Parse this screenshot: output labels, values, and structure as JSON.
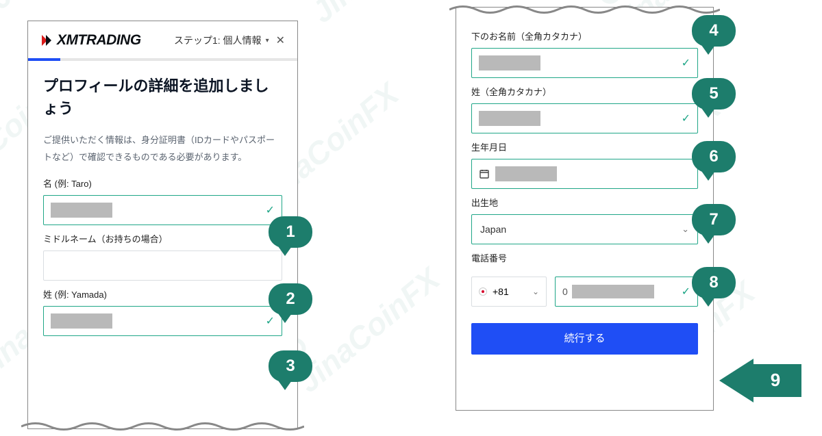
{
  "logo": "XMTRADING",
  "step": "ステップ1: 個人情報",
  "title": "プロフィールの詳細を追加しましょう",
  "desc": "ご提供いただく情報は、身分証明書（IDカードやパスポートなど）で確認できるものである必要があります。",
  "left": {
    "f1": "名 (例: Taro)",
    "f2": "ミドルネーム（お持ちの場合）",
    "f3": "姓 (例: Yamada)"
  },
  "right": {
    "f4": "下のお名前（全角カタカナ）",
    "f5": "姓（全角カタカナ）",
    "f6": "生年月日",
    "f7": "出生地",
    "f7v": "Japan",
    "f8": "電話番号",
    "ccode": "+81",
    "pprefix": "0",
    "btn": "続行する"
  },
  "callouts": {
    "c1": "1",
    "c2": "2",
    "c3": "3",
    "c4": "4",
    "c5": "5",
    "c6": "6",
    "c7": "7",
    "c8": "8",
    "c9": "9"
  },
  "watermark": "JinaCoinFX"
}
